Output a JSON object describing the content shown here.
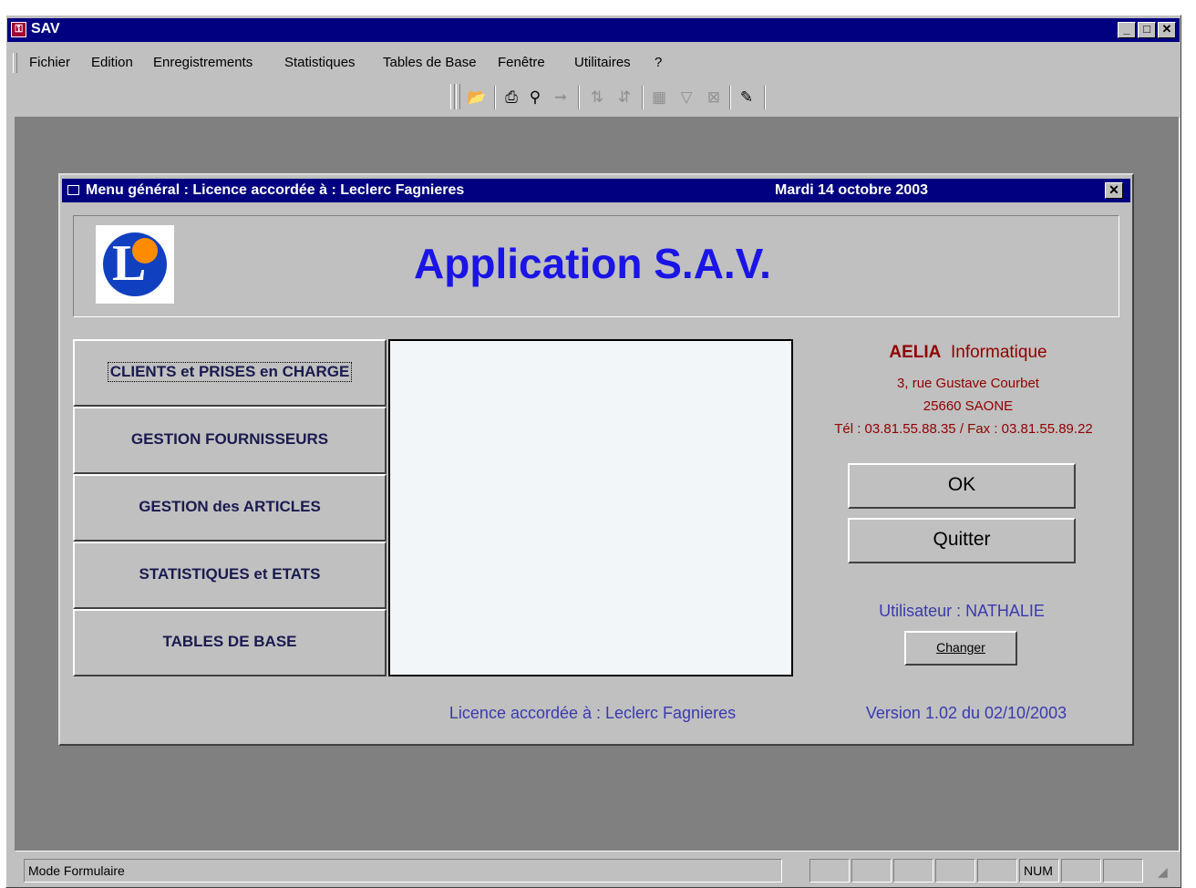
{
  "app": {
    "title": "SAV",
    "controls": {
      "minimize": "_",
      "maximize": "□",
      "close": "✕"
    }
  },
  "menu": {
    "items": [
      "Fichier",
      "Edition",
      "Enregistrements",
      "Statistiques",
      "Tables de Base",
      "Fenêtre",
      "Utilitaires",
      "?"
    ]
  },
  "toolbar": {
    "icons": [
      "open-folder-icon",
      "print-icon",
      "binoculars-find-icon",
      "find-next-icon",
      "sort-ascending-icon",
      "sort-descending-icon",
      "filter-by-form-icon",
      "apply-filter-icon",
      "remove-filter-icon",
      "save-edit-icon"
    ]
  },
  "form": {
    "title": "Menu général  : Licence accordée à : Leclerc Fagnieres",
    "date": "Mardi 14 octobre 2003",
    "close": "✕",
    "heading": "Application S.A.V.",
    "nav": [
      "CLIENTS et PRISES en CHARGE",
      "GESTION FOURNISSEURS",
      "GESTION des ARTICLES",
      "STATISTIQUES et ETATS",
      "TABLES DE BASE"
    ],
    "company": {
      "name": "AELIA",
      "suffix": "Informatique",
      "street": "3, rue Gustave Courbet",
      "city": "25660 SAONE",
      "phone": "Tél : 03.81.55.88.35 / Fax : 03.81.55.89.22"
    },
    "ok_label": "OK",
    "quit_label": "Quitter",
    "user_label": "Utilisateur : NATHALIE",
    "change_label": "Changer",
    "licence": "Licence accordée à : Leclerc Fagnieres",
    "version": "Version 1.02 du 02/10/2003"
  },
  "status": {
    "mode": "Mode Formulaire",
    "num": "NUM"
  },
  "colors": {
    "titlebar": "#000080",
    "face": "#c0c0c0",
    "workspace": "#808080",
    "heading": "#1a14e6",
    "company": "#900000",
    "footer_text": "#3a3ab0"
  }
}
